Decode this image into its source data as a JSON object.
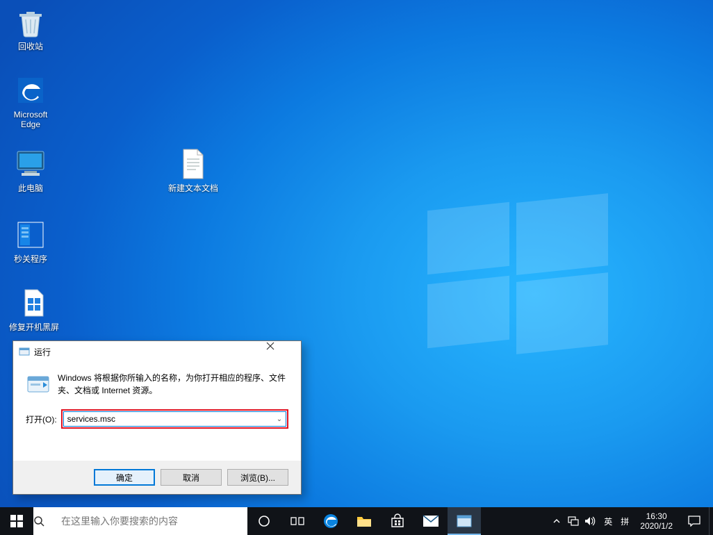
{
  "desktop_icons": {
    "recycle_bin": "回收站",
    "edge": "Microsoft Edge",
    "this_pc": "此电脑",
    "text_doc": "新建文本文档",
    "seconds_off": "秒关程序",
    "fix_blackscreen": "修复开机黑屏"
  },
  "run_dialog": {
    "title": "运行",
    "description": "Windows 将根据你所输入的名称，为你打开相应的程序、文件夹、文档或 Internet 资源。",
    "open_label": "打开(O):",
    "input_value": "services.msc",
    "ok": "确定",
    "cancel": "取消",
    "browse": "浏览(B)..."
  },
  "taskbar": {
    "search_placeholder": "在这里输入你要搜索的内容",
    "ime_lang": "英",
    "ime_mode": "拼",
    "clock_time": "16:30",
    "clock_date": "2020/1/2"
  }
}
